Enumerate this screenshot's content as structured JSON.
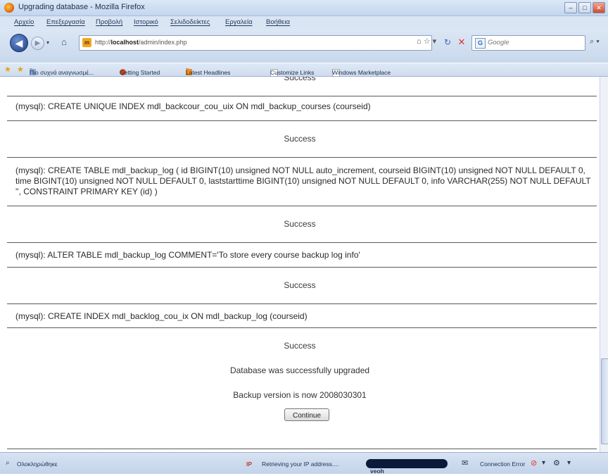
{
  "window": {
    "title": "Upgrading database - Mozilla Firefox"
  },
  "menu": {
    "items": [
      "Αρχείο",
      "Επεξεργασία",
      "Προβολή",
      "Ιστορικό",
      "Σελιδοδείκτες",
      "Εργαλεία",
      "Βοήθεια"
    ]
  },
  "nav": {
    "url_prefix": "http://",
    "url_host": "localhost",
    "url_path": "/admin/index.php",
    "search_placeholder": "Google"
  },
  "bookmarks": {
    "items": [
      "Πιο συχνά αναγνωσμέ...",
      "Getting Started",
      "Latest Headlines",
      "Customize Links",
      "Windows Marketplace"
    ]
  },
  "content": {
    "partial_top": "Success",
    "sql_1": "(mysql): CREATE UNIQUE INDEX mdl_backcour_cou_uix ON mdl_backup_courses (courseid)",
    "success_1": "Success",
    "sql_2": "(mysql): CREATE TABLE mdl_backup_log ( id BIGINT(10) unsigned NOT NULL auto_increment, courseid BIGINT(10) unsigned NOT NULL DEFAULT 0, time BIGINT(10) unsigned NOT NULL DEFAULT 0, laststarttime BIGINT(10) unsigned NOT NULL DEFAULT 0, info VARCHAR(255) NOT NULL DEFAULT '', CONSTRAINT PRIMARY KEY (id) )",
    "success_2": "Success",
    "sql_3": "(mysql): ALTER TABLE mdl_backup_log COMMENT='To store every course backup log info'",
    "success_3": "Success",
    "sql_4": "(mysql): CREATE INDEX mdl_backlog_cou_ix ON mdl_backup_log (courseid)",
    "success_4": "Success",
    "upgraded_msg": "Database was successfully upgraded",
    "version_msg": "Backup version is now 2008030301",
    "continue_label": "Continue"
  },
  "status": {
    "left": "Ολοκληρώθηκε",
    "ip_text": "Retrieving your IP address....",
    "veoh": "veoh",
    "connection": "Connection Error"
  }
}
